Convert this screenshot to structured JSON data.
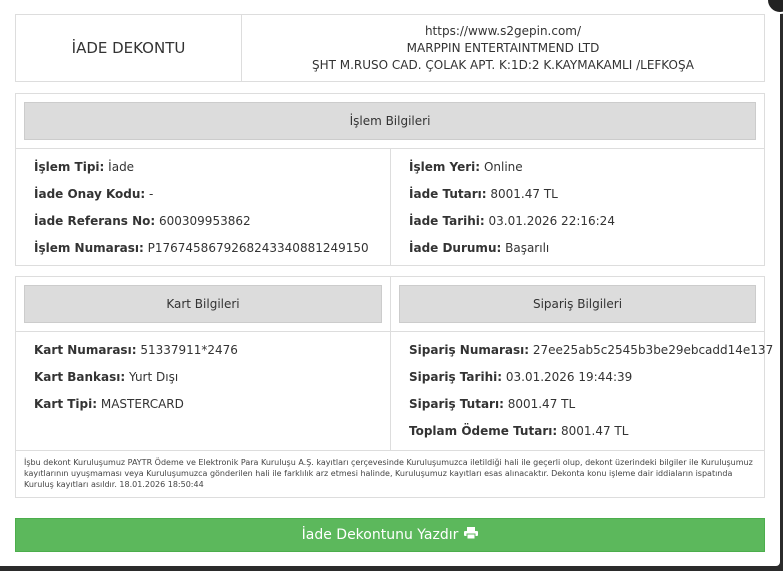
{
  "header": {
    "title": "İADE DEKONTU",
    "url": "https://www.s2gepin.com/",
    "company": "MARPPIN ENTERTAINTMEND LTD",
    "address": "ŞHT M.RUSO CAD. ÇOLAK APT. K:1D:2 K.KAYMAKAMLI /LEFKOŞA"
  },
  "islem": {
    "title": "İşlem Bilgileri",
    "left": [
      {
        "label": "İşlem Tipi:",
        "value": "İade"
      },
      {
        "label": "İade Onay Kodu:",
        "value": "-"
      },
      {
        "label": "İade Referans No:",
        "value": "600309953862"
      },
      {
        "label": "İşlem Numarası:",
        "value": "P1767458679268243340881249150"
      }
    ],
    "right": [
      {
        "label": "İşlem Yeri:",
        "value": "Online"
      },
      {
        "label": "İade Tutarı:",
        "value": "8001.47 TL"
      },
      {
        "label": "İade Tarihi:",
        "value": "03.01.2026 22:16:24"
      },
      {
        "label": "İade Durumu:",
        "value": "Başarılı"
      }
    ]
  },
  "kart": {
    "title": "Kart Bilgileri",
    "rows": [
      {
        "label": "Kart Numarası:",
        "value": "51337911*2476"
      },
      {
        "label": "Kart Bankası:",
        "value": "Yurt Dışı"
      },
      {
        "label": "Kart Tipi:",
        "value": "MASTERCARD"
      }
    ]
  },
  "siparis": {
    "title": "Sipariş Bilgileri",
    "rows": [
      {
        "label": "Sipariş Numarası:",
        "value": "27ee25ab5c2545b3be29ebcadd14e137"
      },
      {
        "label": "Sipariş Tarihi:",
        "value": "03.01.2026 19:44:39"
      },
      {
        "label": "Sipariş Tutarı:",
        "value": "8001.47 TL"
      },
      {
        "label": "Toplam Ödeme Tutarı:",
        "value": "8001.47 TL"
      }
    ]
  },
  "disclaimer": "İşbu dekont Kuruluşumuz PAYTR Ödeme ve Elektronik Para Kuruluşu A.Ş. kayıtları çerçevesinde Kuruluşumuzca iletildiği hali ile geçerli olup, dekont üzerindeki bilgiler ile Kuruluşumuz kayıtlarının uyuşmaması veya Kuruluşumuzca gönderilen hali ile farklılık arz etmesi halinde, Kuruluşumuz kayıtları esas alınacaktır. Dekonta konu işleme dair iddiaların ispatında Kuruluş kayıtları asıldır. 18.01.2026 18:50:44",
  "print_button": {
    "label": "İade Dekontunu Yazdır",
    "icon": "printer-icon"
  },
  "close_icon": "close-icon"
}
